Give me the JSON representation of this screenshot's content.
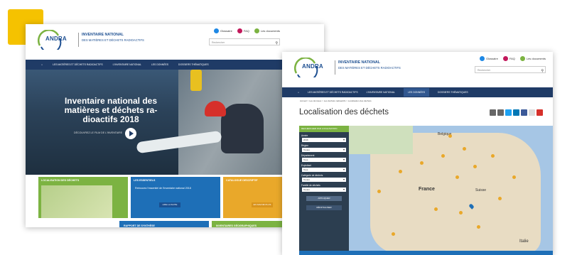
{
  "colors": {
    "accent": "#f5c200",
    "nav": "#1f3b66",
    "green": "#7cb342",
    "blue": "#1e6fb7",
    "orange": "#e9a82a"
  },
  "site": {
    "logo": "ANDRA",
    "brand_line1": "INVENTAIRE NATIONAL",
    "brand_line2": "DES MATIÈRES ET DÉCHETS RADIOACTIFS",
    "top_links": [
      {
        "label": "Glossaire",
        "color": "#1e88e5",
        "icon": "book-icon"
      },
      {
        "label": "FAQ",
        "color": "#c2185b",
        "icon": "question-icon"
      },
      {
        "label": "Les documents",
        "color": "#7cb342",
        "icon": "document-icon"
      }
    ],
    "search_placeholder": "Rechercher",
    "nav": [
      "LES MATIÈRES ET DÉCHETS RADIOACTIFS",
      "L'INVENTAIRE NATIONAL",
      "LES DONNÉES",
      "DOSSIERS THÉMATIQUES"
    ]
  },
  "home": {
    "hero_title": "Inventaire national des matières et déchets ra-dioactifs 2018",
    "hero_small": "DÉCOUVREZ LE FILM DE L'INVENTAIRE",
    "tiles": [
      {
        "label": "LOCALISATION DES DÉCHETS"
      },
      {
        "label": "LES ESSENTIELS",
        "text": "Retrouvez l'essentiel de l'inventaire national 2018",
        "button": "LIRE LA SUITE"
      },
      {
        "label": "CATALOGUE DESCRIPTIF",
        "button": "EN SAVOIR PLUS"
      }
    ],
    "tiles_row2": [
      "RAPPORT DE SYNTHÈSE",
      "INVENTAIRES GÉOGRAPHIQUES"
    ]
  },
  "data_page": {
    "breadcrumb": "Accueil  >  Les données  >  Les déchets radioactifs  >  Localisation des déchets",
    "title": "Localisation des déchets",
    "filter_head": "RECHERCHER PAR LOCALISATION",
    "filters": [
      {
        "label": "Année",
        "value": "2016"
      },
      {
        "label": "Région",
        "value": "Toutes"
      },
      {
        "label": "Département",
        "value": "Tous"
      },
      {
        "label": "Exploitant",
        "value": "Tous"
      },
      {
        "label": "Catégorie de déchets",
        "value": "Toutes"
      },
      {
        "label": "Famille de déchets",
        "value": "Toutes"
      }
    ],
    "apply": "APPLIQUER",
    "reset": "RÉINITIALISER",
    "map_labels": [
      "Belgique",
      "France",
      "Suisse",
      "Italie"
    ]
  }
}
